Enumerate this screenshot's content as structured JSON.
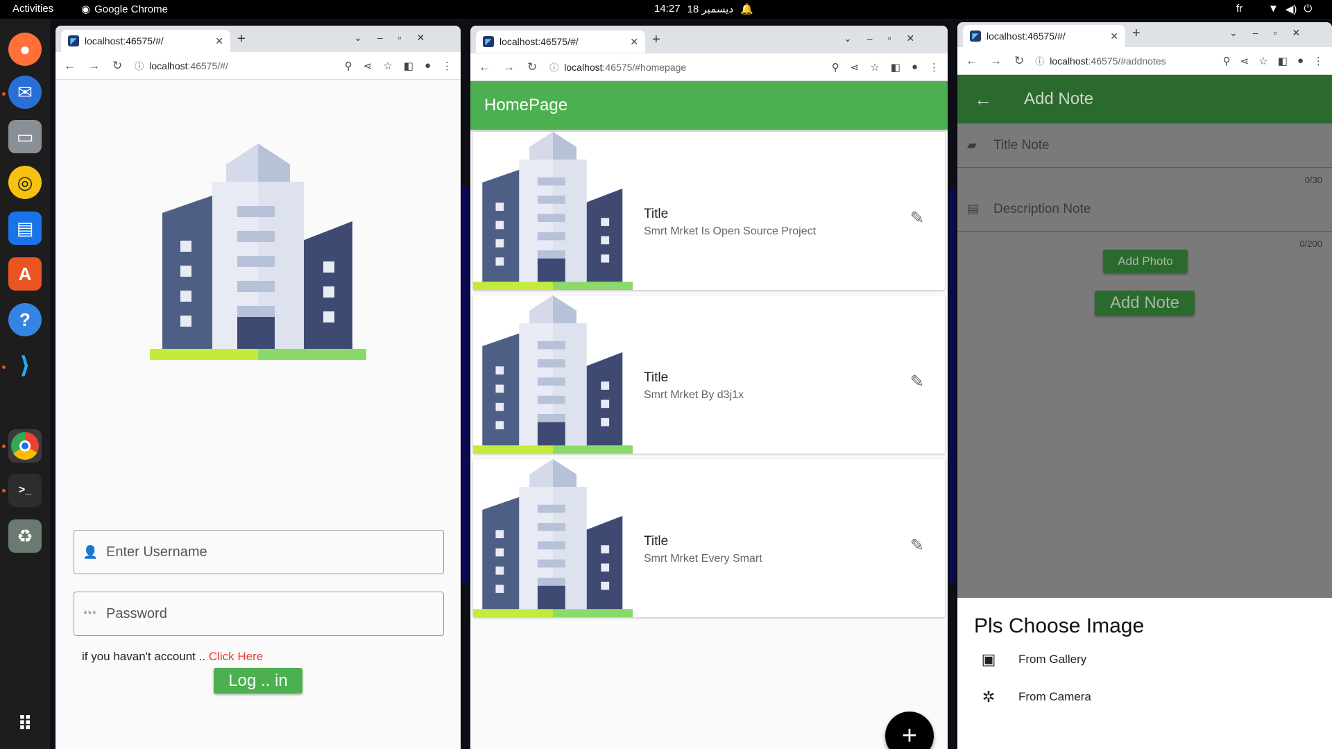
{
  "topbar": {
    "activities": "Activities",
    "app_name": "Google Chrome",
    "clock_time": "14:27",
    "clock_date": "18 ديسمبر",
    "lang": "fr"
  },
  "windows": {
    "login": {
      "tab_title": "localhost:46575/#/",
      "url_host": "localhost",
      "url_rest": ":46575/#/",
      "username_placeholder": "Enter Username",
      "password_placeholder": "Password",
      "no_account_text": "if you havan't account ..",
      "click_here": "Click Here",
      "login_button": "Log .. in"
    },
    "home": {
      "tab_title": "localhost:46575/#/",
      "url_host": "localhost",
      "url_rest": ":46575/#homepage",
      "appbar_title": "HomePage",
      "notes": [
        {
          "title": "Title",
          "subtitle": "Smrt Mrket Is Open Source Project"
        },
        {
          "title": "Title",
          "subtitle": "Smrt Mrket By d3j1x"
        },
        {
          "title": "Title",
          "subtitle": "Smrt Mrket Every Smart"
        }
      ],
      "fab_label": "+"
    },
    "addnote": {
      "tab_title": "localhost:46575/#/",
      "url_host": "localhost",
      "url_rest": ":46575/#addnotes",
      "appbar_title": "Add Note",
      "title_placeholder": "Title Note",
      "title_counter": "0/30",
      "description_placeholder": "Description Note",
      "description_counter": "0/200",
      "add_photo_button": "Add Photo",
      "add_note_button": "Add Note",
      "sheet_title": "Pls Choose Image",
      "option_gallery": "From Gallery",
      "option_camera": "From Camera"
    }
  },
  "colors": {
    "green": "#4caf50",
    "dark_green": "#2b6a2d",
    "link_red": "#e53935"
  }
}
